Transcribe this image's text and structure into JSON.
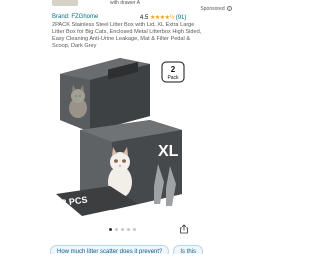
{
  "top": {
    "partial_text": "with drawer A"
  },
  "sponsored": {
    "label": "Sponsored",
    "info": "i"
  },
  "product": {
    "brand": "Brand: FZGhome",
    "rating_value": "4.5",
    "stars": "★★★★½",
    "rating_count": "(91)",
    "title": "2PACK Stainless Steel Litter Box with Lid, XL Extra Large Litter Box for Big Cats, Enclosed Metal Litterbox High Sided, Easy Cleaning Anti-Urine Leakage, Mat & Filter Pedal & Scoop, Dark Grey",
    "image": {
      "badge_line1": "2",
      "badge_line2": "Pack",
      "size_label": "XL",
      "bottom_label": "2 PCS"
    }
  },
  "carousel": {
    "count": 5,
    "active": 0
  },
  "chips": [
    "How much litter scatter does it prevent?",
    "Is this"
  ],
  "colors": {
    "link": "#007185",
    "star": "#f0a100",
    "chip_bg": "#f0f7fc",
    "chip_text": "#0f5a8a"
  }
}
